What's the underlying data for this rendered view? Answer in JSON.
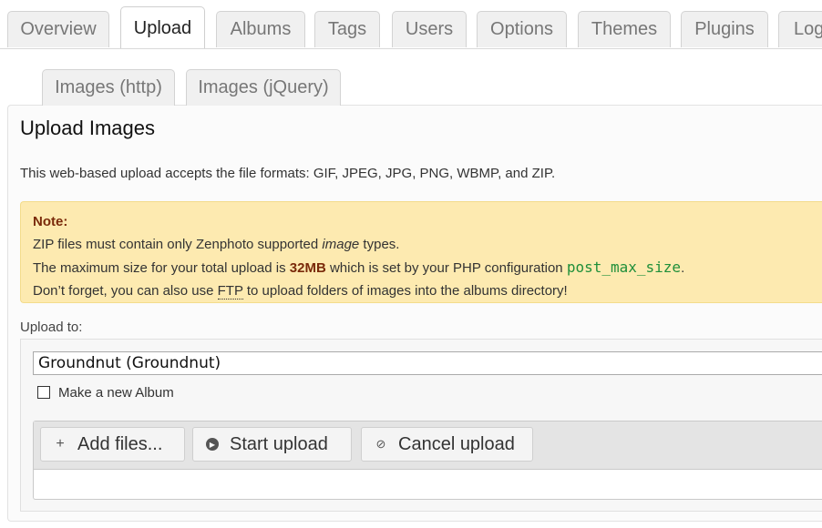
{
  "main_tabs": [
    {
      "label": "Overview"
    },
    {
      "label": "Upload",
      "active": true
    },
    {
      "label": "Albums"
    },
    {
      "label": "Tags"
    },
    {
      "label": "Users"
    },
    {
      "label": "Options"
    },
    {
      "label": "Themes"
    },
    {
      "label": "Plugins"
    },
    {
      "label": "Log"
    }
  ],
  "sub_tabs": [
    {
      "label": "Images (http)"
    },
    {
      "label": "Images (jQuery)",
      "active": true
    }
  ],
  "panel": {
    "title": "Upload Images",
    "intro": "This web-based upload accepts the file formats: GIF, JPEG, JPG, PNG, WBMP, and ZIP."
  },
  "note": {
    "title": "Note:",
    "line1_a": "ZIP files must contain only Zenphoto supported ",
    "line1_em": "image",
    "line1_b": " types.",
    "line2_a": "The maximum size for your total upload is ",
    "line2_size": "32MB",
    "line2_b": " which is set by your PHP configuration ",
    "line2_code": "post_max_size",
    "line2_c": ".",
    "line3_a": "Don’t forget, you can also use ",
    "line3_ftp": "FTP",
    "line3_b": " to upload folders of images into the albums directory!"
  },
  "upload": {
    "label": "Upload to:",
    "album_value": "Groundnut (Groundnut)",
    "new_album_label": "Make a new Album",
    "new_album_checked": false
  },
  "fileupload": {
    "add_label": "Add files...",
    "start_label": "Start upload",
    "cancel_label": "Cancel upload",
    "add_icon": "plus-icon",
    "start_icon": "play-circle-icon",
    "cancel_icon": "cancel-icon"
  },
  "colors": {
    "note_bg": "#fdeab0",
    "note_strong": "#7a2a0a",
    "code_green": "#1f8f3a"
  }
}
